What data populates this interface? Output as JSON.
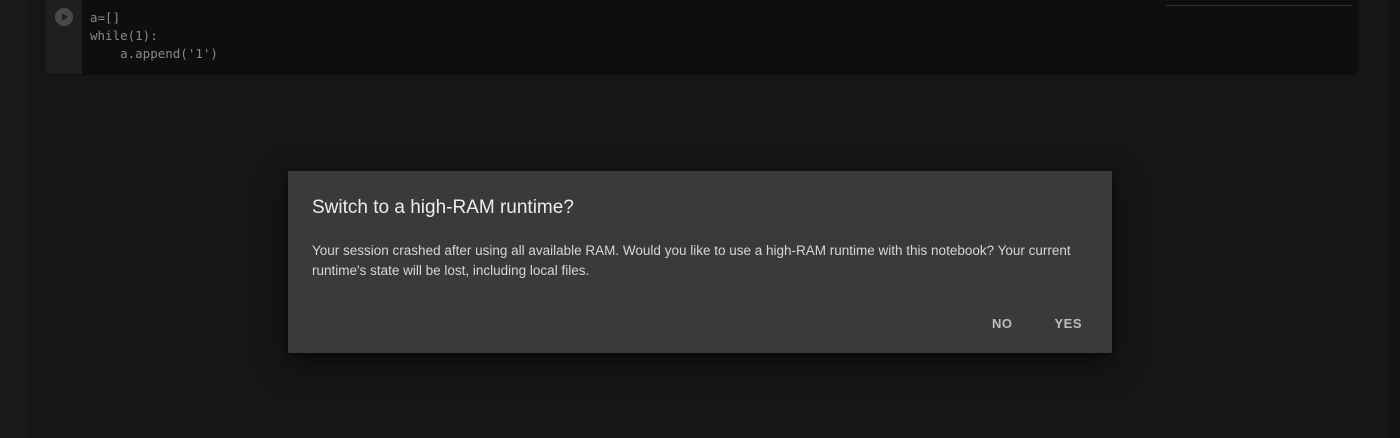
{
  "notebook": {
    "cell": {
      "code_lines": [
        "a=[]",
        "while(1):",
        "    a.append('1')"
      ]
    }
  },
  "dialog": {
    "title": "Switch to a high-RAM runtime?",
    "body": "Your session crashed after using all available RAM. Would you like to use a high-RAM runtime with this notebook? Your current runtime's state will be lost, including local files.",
    "no_label": "NO",
    "yes_label": "YES"
  },
  "icons": {
    "run": "play-icon"
  }
}
